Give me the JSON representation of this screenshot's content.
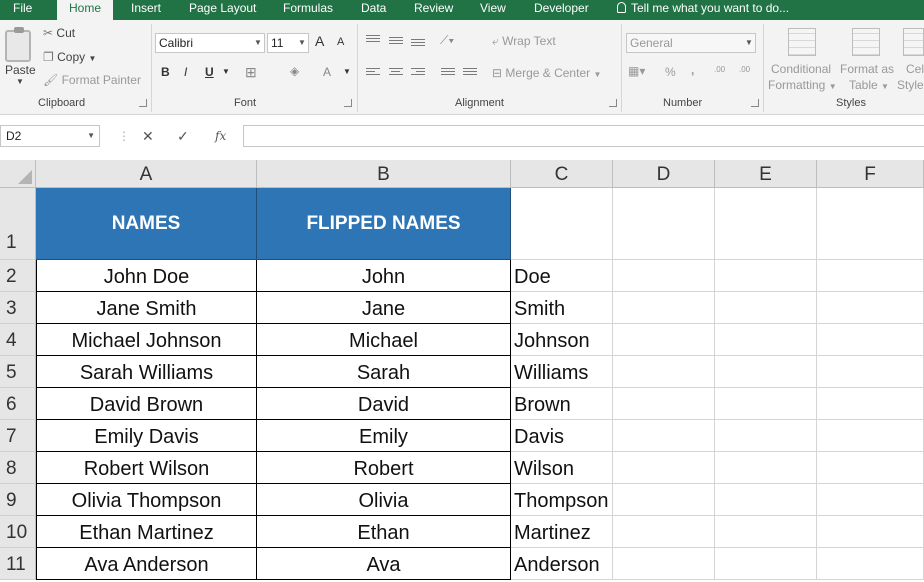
{
  "ribbon_tabs": [
    "File",
    "Home",
    "Insert",
    "Page Layout",
    "Formulas",
    "Data",
    "Review",
    "View",
    "Developer"
  ],
  "active_tab": "Home",
  "tell_me": "Tell me what you want to do...",
  "clipboard": {
    "paste_label": "Paste",
    "cut_label": "Cut",
    "copy_label": "Copy",
    "format_painter_label": "Format Painter",
    "group_label": "Clipboard"
  },
  "font": {
    "font_name": "Calibri",
    "font_size": "11",
    "bold": "B",
    "italic": "I",
    "underline": "U",
    "grow": "A",
    "shrink": "A",
    "font_color": "A",
    "group_label": "Font"
  },
  "alignment": {
    "wrap_text": "Wrap Text",
    "merge_center": "Merge & Center",
    "group_label": "Alignment"
  },
  "number": {
    "format": "General",
    "percent": "%",
    "comma": ",",
    "increase_decimal": ".00",
    "decrease_decimal": ".00",
    "group_label": "Number"
  },
  "styles": {
    "conditional_formatting_1": "Conditional",
    "conditional_formatting_2": "Formatting",
    "format_table_1": "Format as",
    "format_table_2": "Table",
    "cell_styles_1": "Cell",
    "cell_styles_2": "Styles",
    "group_label": "Styles"
  },
  "formula_bar": {
    "name_box": "D2",
    "cancel": "✕",
    "enter": "✓",
    "fx": "fx",
    "formula": ""
  },
  "columns": [
    "A",
    "B",
    "C",
    "D",
    "E",
    "F"
  ],
  "rows": [
    "1",
    "2",
    "3",
    "4",
    "5",
    "6",
    "7",
    "8",
    "9",
    "10",
    "11"
  ],
  "table": {
    "header_a": "NAMES",
    "header_b": "FLIPPED NAMES",
    "header_fill": "#2e75b6",
    "data": [
      {
        "a": "John Doe",
        "b": "John",
        "c": "Doe"
      },
      {
        "a": "Jane Smith",
        "b": "Jane",
        "c": "Smith"
      },
      {
        "a": "Michael Johnson",
        "b": "Michael",
        "c": "Johnson"
      },
      {
        "a": "Sarah Williams",
        "b": "Sarah",
        "c": "Williams"
      },
      {
        "a": "David Brown",
        "b": "David",
        "c": "Brown"
      },
      {
        "a": "Emily Davis",
        "b": "Emily",
        "c": "Davis"
      },
      {
        "a": "Robert Wilson",
        "b": "Robert",
        "c": "Wilson"
      },
      {
        "a": "Olivia Thompson",
        "b": "Olivia",
        "c": "Thompson"
      },
      {
        "a": "Ethan Martinez",
        "b": "Ethan",
        "c": "Martinez"
      },
      {
        "a": "Ava Anderson",
        "b": "Ava",
        "c": "Anderson"
      }
    ]
  },
  "colors": {
    "ribbon_green": "#217346",
    "ribbon_bg": "#f3f3f3",
    "header_gray": "#e6e6e6"
  }
}
